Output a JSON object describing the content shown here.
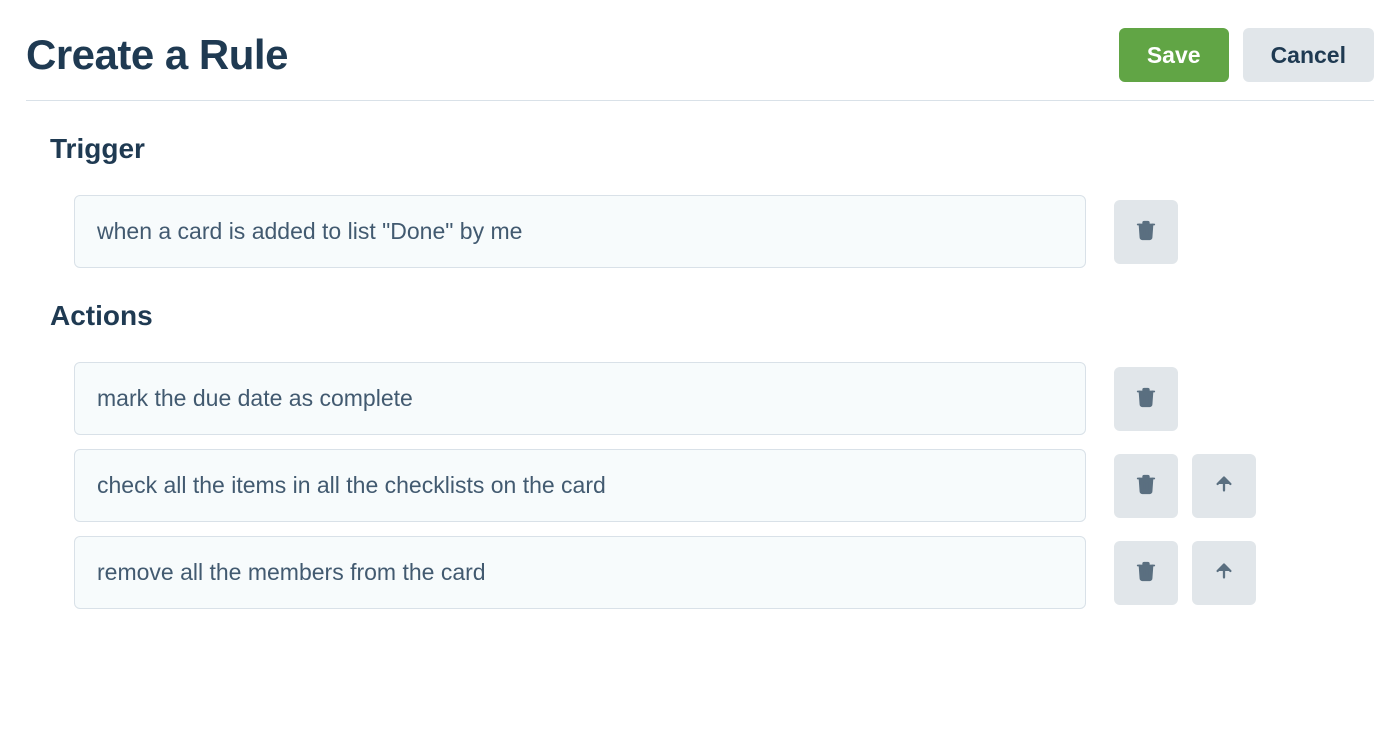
{
  "header": {
    "title": "Create a Rule",
    "save_label": "Save",
    "cancel_label": "Cancel"
  },
  "trigger": {
    "heading": "Trigger",
    "text": "when a card is added to list \"Done\" by me"
  },
  "actions": {
    "heading": "Actions",
    "items": [
      {
        "text": "mark the due date as complete",
        "has_move_up": false
      },
      {
        "text": "check all the items in all the checklists on the card",
        "has_move_up": true
      },
      {
        "text": "remove all the members from the card",
        "has_move_up": true
      }
    ]
  }
}
